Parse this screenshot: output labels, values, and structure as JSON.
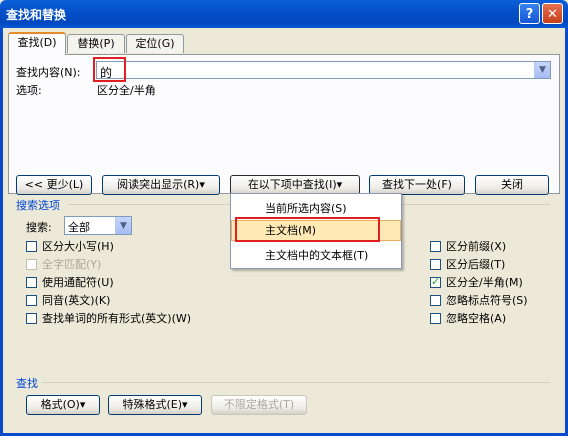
{
  "window": {
    "title": "查找和替换",
    "help_label": "?",
    "close_label": "✕"
  },
  "tabs": [
    {
      "label": "查找(D)",
      "active": true
    },
    {
      "label": "替换(P)",
      "active": false
    },
    {
      "label": "定位(G)",
      "active": false
    }
  ],
  "find": {
    "label": "查找内容(N):",
    "value": "的",
    "options_label": "选项:",
    "options_value": "区分全/半角"
  },
  "buttons": {
    "less": "<< 更少(L)",
    "reading_highlight": "阅读突出显示(R)▾",
    "find_in": "在以下项中查找(I)▾",
    "find_next": "查找下一处(F)",
    "close": "关闭"
  },
  "find_in_menu": {
    "items": [
      {
        "label": "当前所选内容(S)",
        "highlighted": false
      },
      {
        "label": "主文档(M)",
        "highlighted": true
      },
      {
        "label": "主文档中的文本框(T)",
        "highlighted": false
      }
    ]
  },
  "search_options": {
    "title": "搜索选项",
    "search_label": "搜索:",
    "search_value": "全部",
    "left_checks": [
      {
        "label": "区分大小写(H)",
        "checked": false,
        "disabled": false
      },
      {
        "label": "全字匹配(Y)",
        "checked": false,
        "disabled": true
      },
      {
        "label": "使用通配符(U)",
        "checked": false,
        "disabled": false
      },
      {
        "label": "同音(英文)(K)",
        "checked": false,
        "disabled": false
      },
      {
        "label": "查找单词的所有形式(英文)(W)",
        "checked": false,
        "disabled": false
      }
    ],
    "right_checks": [
      {
        "label": "区分前缀(X)",
        "checked": false
      },
      {
        "label": "区分后缀(T)",
        "checked": false
      },
      {
        "label": "区分全/半角(M)",
        "checked": true
      },
      {
        "label": "忽略标点符号(S)",
        "checked": false
      },
      {
        "label": "忽略空格(A)",
        "checked": false
      }
    ]
  },
  "find_section": {
    "title": "查找",
    "format_button": "格式(O)▾",
    "special_button": "特殊格式(E)▾",
    "no_format_button": "不限定格式(T)"
  },
  "colors": {
    "title_bar": "#0a5fd8",
    "dialog_bg": "#ece9d8",
    "group_title": "#0046d5",
    "highlight_box": "#e02020",
    "menu_highlight": "#ffe9b5"
  }
}
